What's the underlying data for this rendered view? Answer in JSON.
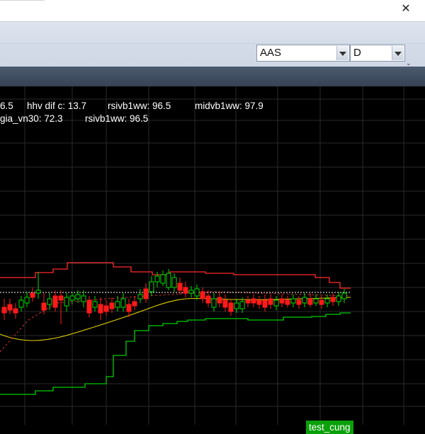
{
  "window": {
    "close_glyph": "✕"
  },
  "toolbar": {
    "symbol_select": {
      "value": "AAS"
    },
    "timeframe_select": {
      "value": "D"
    },
    "overflow_glyph": "⌄"
  },
  "chart": {
    "legend_line1": [
      {
        "key": "l1a",
        "text": "6.5"
      },
      {
        "key": "l1b",
        "text": "hhv dif c: 13.7"
      },
      {
        "key": "l1c",
        "text": "rsivb1ww: 96.5"
      },
      {
        "key": "l1d",
        "text": "midvb1ww: 97.9"
      }
    ],
    "legend_line2": [
      {
        "key": "l2a",
        "text": "gia_vn30: 72.3"
      },
      {
        "key": "l2b",
        "text": "rsivb1ww: 96.5"
      }
    ],
    "signal_label": "test_cung",
    "colors": {
      "background": "#000000",
      "up": "#00dd00",
      "down": "#ff1a1a",
      "upper_band": "#ff2a2a",
      "lower_band": "#00cc00",
      "mid_line": "#e8d400",
      "grid": "#2a2a2a",
      "ref_line": "#ffffff"
    }
  },
  "chart_data": {
    "type": "candlestick",
    "symbol": "AAS",
    "timeframe": "D"
  }
}
